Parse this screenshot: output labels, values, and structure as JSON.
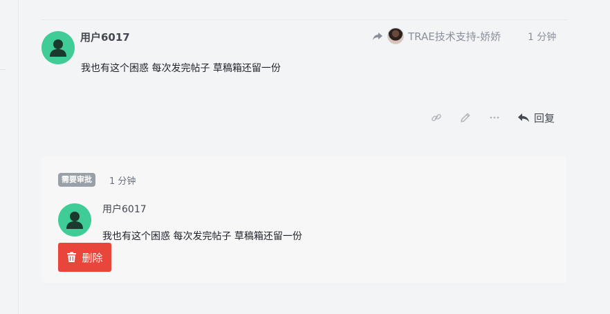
{
  "post": {
    "username": "用户6017",
    "reply_to": {
      "name": "TRAE技术支持-娇娇",
      "share_icon": "share-forward-icon",
      "avatar_icon": "avatar-photo"
    },
    "time": "1 分钟",
    "body": "我也有这个困惑 每次发完帖子 草稿箱还留一份",
    "actions": {
      "link_icon": "link-icon",
      "edit_icon": "pencil-icon",
      "more_icon": "ellipsis-icon",
      "reply_icon": "reply-arrow-icon",
      "reply_label": "回复"
    }
  },
  "pending": {
    "badge": "需要审批",
    "time": "1 分钟",
    "username": "用户6017",
    "body": "我也有这个困惑 每次发完帖子 草稿箱还留一份",
    "delete_label": "删除",
    "delete_icon": "trash-icon"
  },
  "colors": {
    "avatar": "#3fcc96",
    "danger": "#e8453b",
    "badge": "#9aa0a8",
    "background": "#f3f4f6"
  }
}
